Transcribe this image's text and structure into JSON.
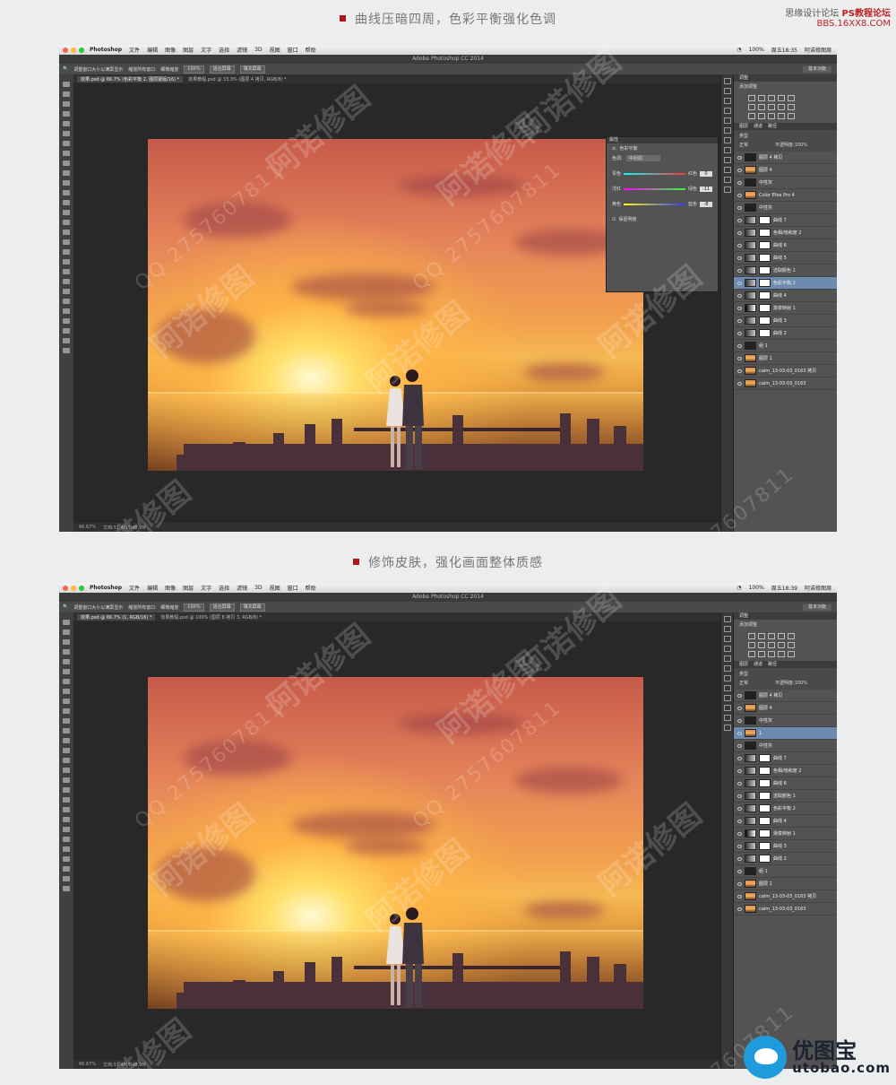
{
  "site_logo": {
    "text": "思缘设计论坛",
    "ps": "PS教程论坛",
    "url": "BBS.16XX8.COM"
  },
  "captions": [
    "曲线压暗四周，色彩平衡强化色调",
    "修饰皮肤，强化画面整体质感"
  ],
  "watermark": {
    "text": "阿诺修图",
    "qq": "QQ 2757607811"
  },
  "bottom_logo": {
    "cn": "优图宝",
    "en": "utobao.com"
  },
  "colors": {
    "caption_square": "#b01818",
    "selected_layer": "#6d8bb0"
  },
  "menu": {
    "app": "Photoshop",
    "items": [
      "文件",
      "编辑",
      "图像",
      "图层",
      "文字",
      "选择",
      "滤镜",
      "3D",
      "视图",
      "窗口",
      "帮助"
    ],
    "right_battery": "100%",
    "right_user": "阿诺修图周"
  },
  "window_title": "Adobe Photoshop CC 2014",
  "options_bar": {
    "check1": "调整窗口大小以满屏显示",
    "check2": "缩放所有窗口",
    "check3": "细微缩放",
    "zoom100": "100%",
    "fit": "适合屏幕",
    "fill": "填充屏幕",
    "workspace": "基本功能"
  },
  "screens": [
    {
      "tab_active": "效果.psd @ 66.7% (色彩平衡 2, 图层蒙版/16) *",
      "tab_other": "效果教程.psd @ 33.3% (图层 4 拷贝, RGB/8) *",
      "time": "周五18:35",
      "status_zoom": "66.67%",
      "status_doc": "文档:51.4M/848.9M",
      "properties": {
        "title": "属性",
        "panel": "色彩平衡",
        "tone_label": "色调:",
        "tone": "中间调",
        "cyan": "青色",
        "red": "红色",
        "cyan_val": "0",
        "magenta": "洋红",
        "green": "绿色",
        "magenta_val": "-11",
        "yellow": "黄色",
        "blue": "蓝色",
        "yellow_val": "-8",
        "preserve": "保留明度"
      },
      "layers": [
        {
          "name": "图层 4 拷贝",
          "thumb": "dark"
        },
        {
          "name": "图层 4",
          "thumb": "img"
        },
        {
          "name": "中性灰",
          "thumb": "dark"
        },
        {
          "name": "Color Efex Pro 4",
          "thumb": "img"
        },
        {
          "name": "中性灰",
          "thumb": "dark"
        },
        {
          "name": "曲线 7",
          "thumb": "adj"
        },
        {
          "name": "色相/饱和度 2",
          "thumb": "adj"
        },
        {
          "name": "曲线 6",
          "thumb": "adj"
        },
        {
          "name": "曲线 5",
          "thumb": "adj"
        },
        {
          "name": "选取颜色 1",
          "thumb": "adj"
        },
        {
          "name": "色彩平衡 2",
          "thumb": "adj",
          "selected": true
        },
        {
          "name": "曲线 4",
          "thumb": "adj"
        },
        {
          "name": "渐变映射 1",
          "thumb": "grad"
        },
        {
          "name": "曲线 3",
          "thumb": "adj"
        },
        {
          "name": "曲线 2",
          "thumb": "adj"
        },
        {
          "name": "组 1",
          "thumb": "dark"
        },
        {
          "name": "图层 1",
          "thumb": "img"
        },
        {
          "name": "calm_13-03-03_0163 拷贝",
          "thumb": "img"
        },
        {
          "name": "calm_13-03-03_0163",
          "thumb": "img"
        }
      ]
    },
    {
      "tab_active": "效果.psd @ 66.7% (1, RGB/16) *",
      "tab_other": "效果教程.psd @ 100% (图层 8 拷贝 3, RGB/8) *",
      "time": "周五18:39",
      "status_zoom": "66.67%",
      "status_doc": "文档:51.4M/848.9M",
      "layers": [
        {
          "name": "图层 4 拷贝",
          "thumb": "dark"
        },
        {
          "name": "图层 4",
          "thumb": "img"
        },
        {
          "name": "中性灰",
          "thumb": "dark"
        },
        {
          "name": "1",
          "thumb": "img",
          "selected": true
        },
        {
          "name": "中性灰",
          "thumb": "dark"
        },
        {
          "name": "曲线 7",
          "thumb": "adj"
        },
        {
          "name": "色相/饱和度 2",
          "thumb": "adj"
        },
        {
          "name": "曲线 6",
          "thumb": "adj"
        },
        {
          "name": "选取颜色 1",
          "thumb": "adj"
        },
        {
          "name": "色彩平衡 2",
          "thumb": "adj"
        },
        {
          "name": "曲线 4",
          "thumb": "adj"
        },
        {
          "name": "渐变映射 1",
          "thumb": "grad"
        },
        {
          "name": "曲线 3",
          "thumb": "adj"
        },
        {
          "name": "曲线 2",
          "thumb": "adj"
        },
        {
          "name": "组 1",
          "thumb": "dark"
        },
        {
          "name": "图层 1",
          "thumb": "img"
        },
        {
          "name": "calm_13-03-03_0163 拷贝",
          "thumb": "img"
        },
        {
          "name": "calm_13-03-03_0163",
          "thumb": "img"
        }
      ]
    }
  ],
  "panel_labels": {
    "adjust_tab": "调整",
    "add_adjust": "添加调整",
    "layers": "图层",
    "channels": "通道",
    "paths": "路径",
    "kind": "类型",
    "blend": "正常",
    "opacity_label": "不透明度:",
    "opacity": "100%",
    "lock": "锁定:",
    "fill_label": "填充:",
    "fill": "100%"
  }
}
